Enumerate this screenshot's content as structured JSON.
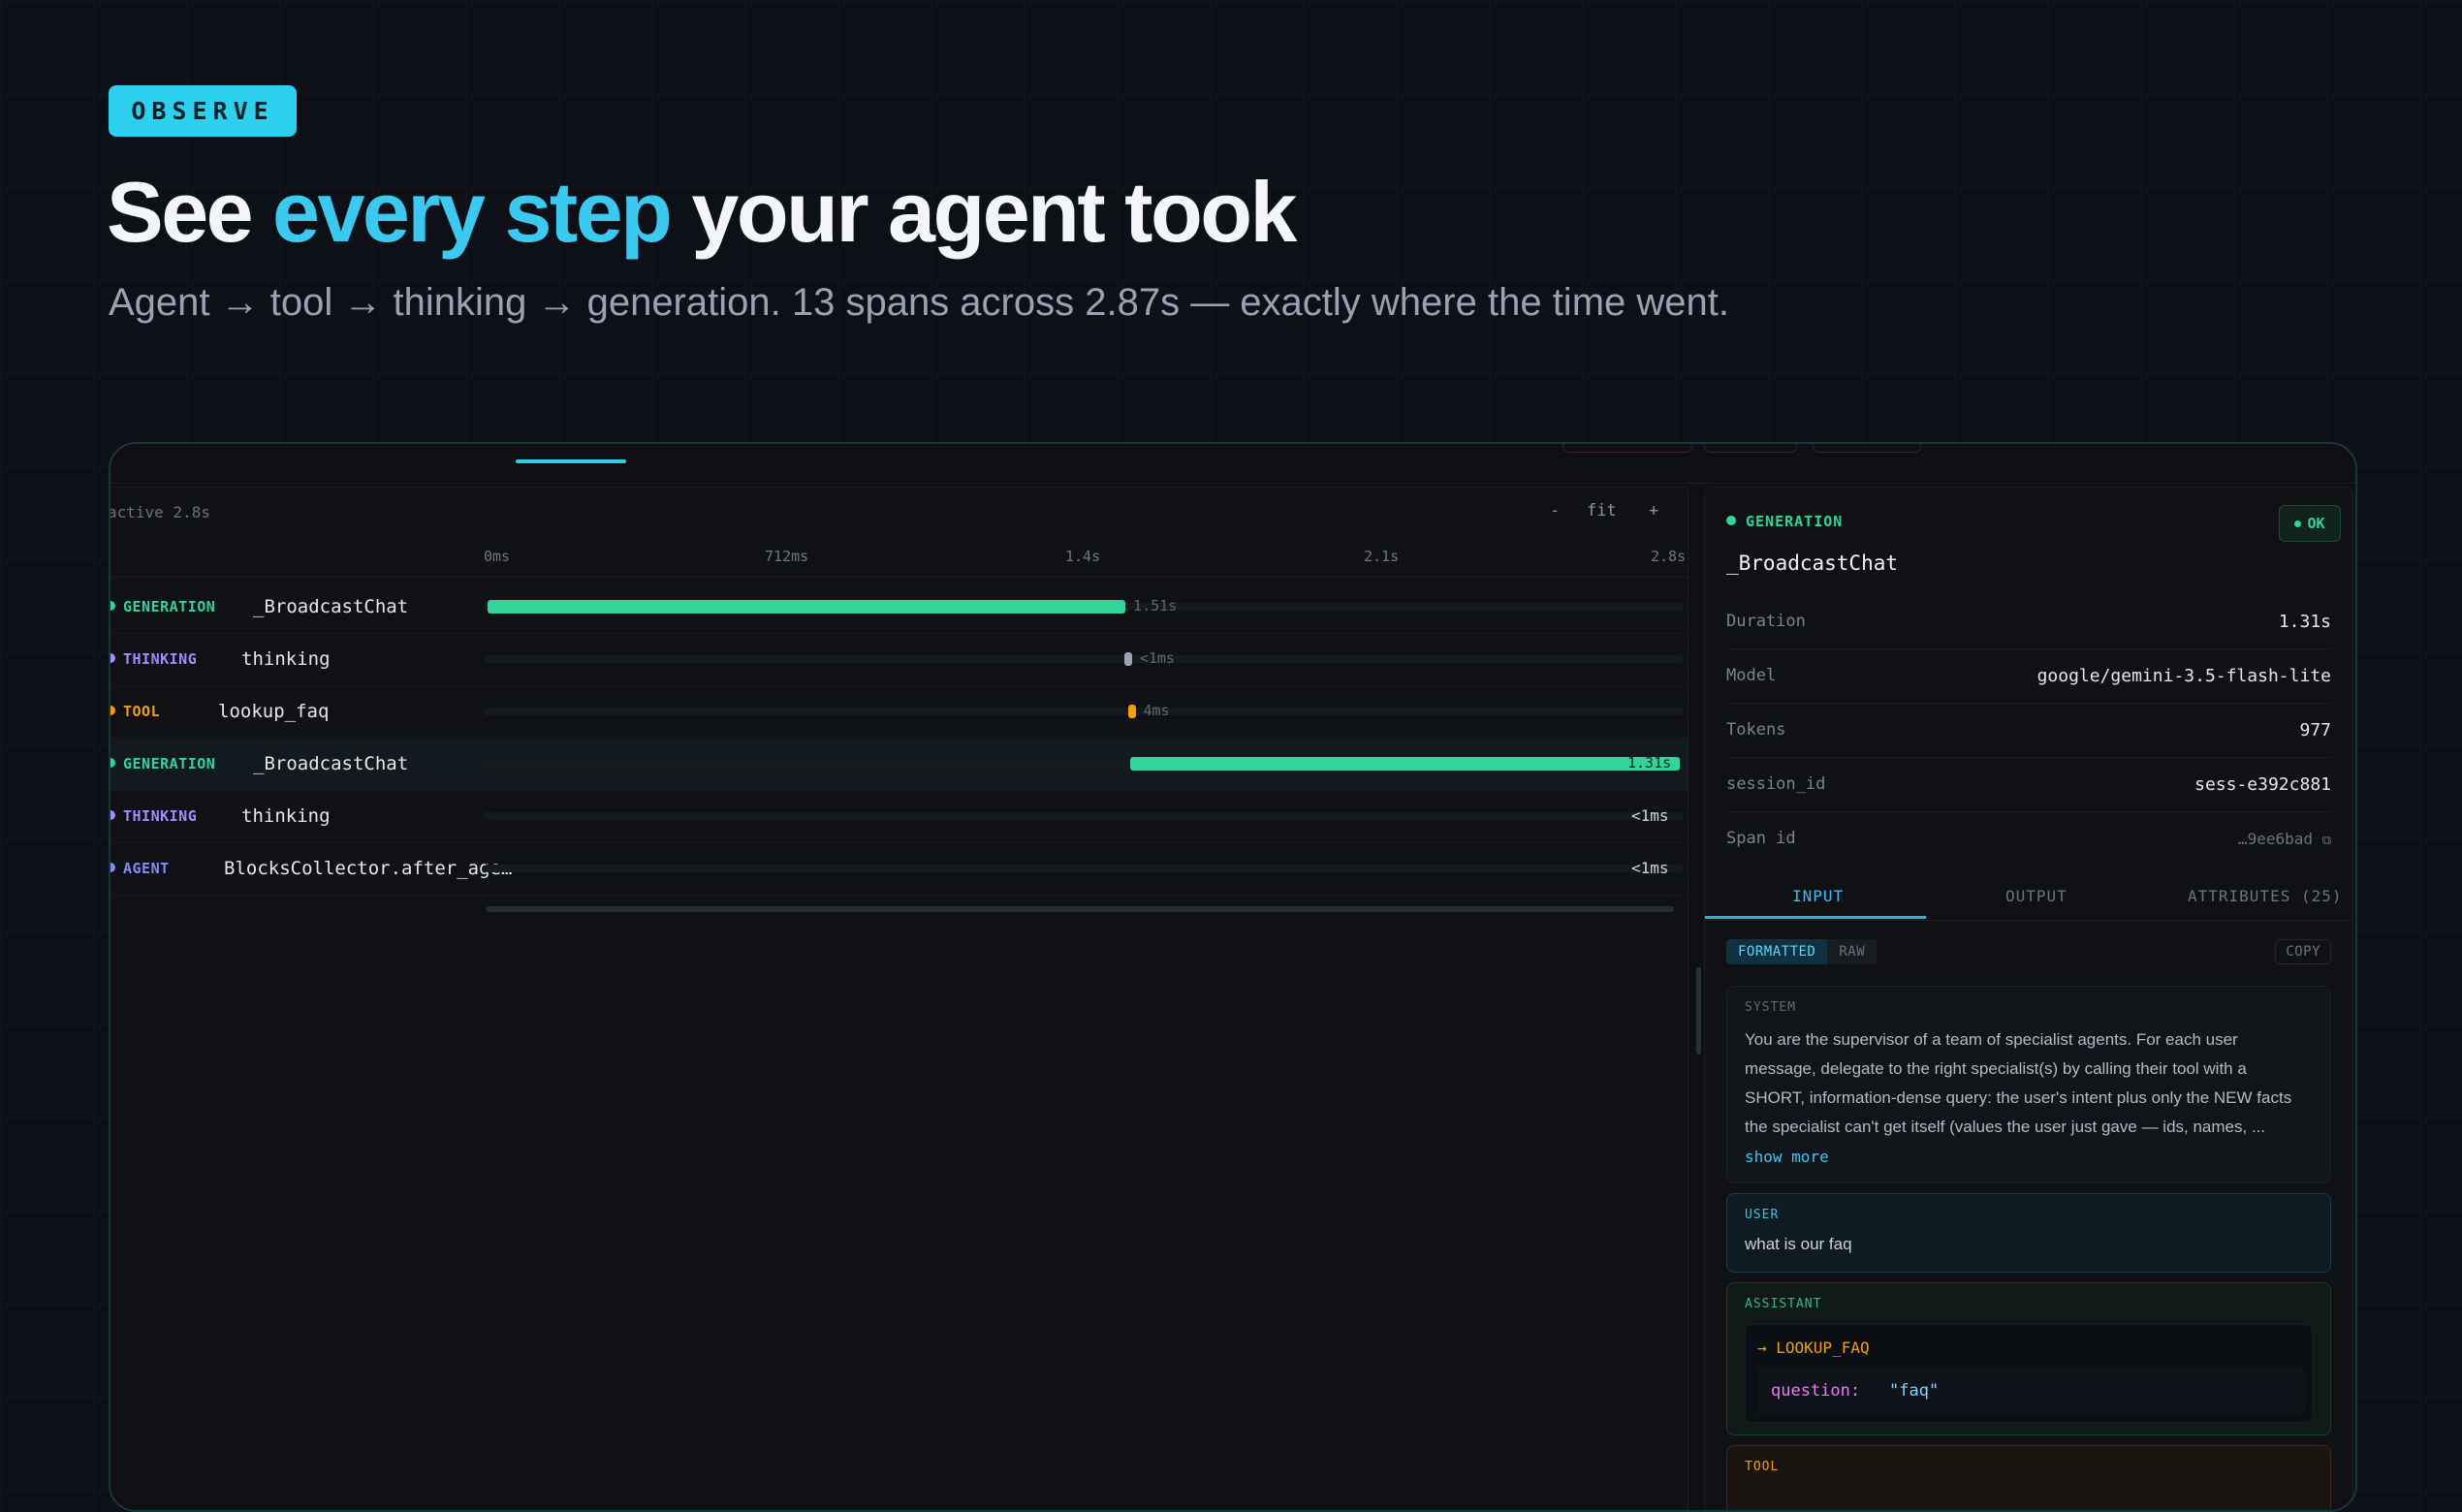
{
  "hero": {
    "badge": "OBSERVE",
    "title_pre": "See ",
    "title_accent": "every step",
    "title_post": " your agent took",
    "subtitle": "Agent → tool → thinking → generation. 13 spans across 2.87s — exactly where the time went."
  },
  "timeline": {
    "active_label": "active 2.8s",
    "zoom_out": "-",
    "zoom_fit": "fit",
    "zoom_in": "+",
    "ticks": [
      "0ms",
      "712ms",
      "1.4s",
      "2.1s",
      "2.8s"
    ],
    "rows": [
      {
        "type": "GENERATION",
        "name": "_BroadcastChat",
        "duration": "1.51s",
        "color": "#34d399",
        "start": 0.0,
        "end": 0.535
      },
      {
        "type": "THINKING",
        "name": "thinking",
        "duration": "<1ms",
        "color": "#a78bfa",
        "start": 0.534,
        "end": 0.54
      },
      {
        "type": "TOOL",
        "name": "lookup_faq",
        "duration": "4ms",
        "color": "#f59e0b",
        "start": 0.537,
        "end": 0.543
      },
      {
        "type": "GENERATION",
        "name": "_BroadcastChat",
        "duration": "1.31s",
        "color": "#34d399",
        "start": 0.539,
        "end": 1.0,
        "selected": true
      },
      {
        "type": "THINKING",
        "name": "thinking",
        "duration": "<1ms",
        "color": "#a78bfa",
        "start": 1.0,
        "end": 1.0
      },
      {
        "type": "AGENT",
        "name": "BlocksCollector.after_age…",
        "duration": "<1ms",
        "color": "#818cf8",
        "start": 1.0,
        "end": 1.0
      }
    ]
  },
  "detail": {
    "kind": "GENERATION",
    "status": "OK",
    "title": "_BroadcastChat",
    "meta": [
      {
        "key": "Duration",
        "value": "1.31s"
      },
      {
        "key": "Model",
        "value": "google/gemini-3.5-flash-lite"
      },
      {
        "key": "Tokens",
        "value": "977"
      },
      {
        "key": "session_id",
        "value": "sess-e392c881"
      },
      {
        "key": "Span id",
        "value": "…9ee6bad"
      }
    ],
    "tabs": [
      "INPUT",
      "OUTPUT",
      "ATTRIBUTES (25)"
    ],
    "format_on": "FORMATTED",
    "format_off": "RAW",
    "copy": "COPY",
    "system_role": "SYSTEM",
    "system_text": "You are the supervisor of a team of specialist agents. For each user message, delegate to the right specialist(s) by calling their tool with a SHORT, information-dense query: the user's intent plus only the NEW facts the specialist can't get itself (values the user just gave — ids, names, ...",
    "show_more": "show more",
    "user_role": "USER",
    "user_text": "what is our faq",
    "assistant_role": "ASSISTANT",
    "tool_call": "→ LOOKUP_FAQ",
    "arg_key": "question:",
    "arg_value": "\"faq\"",
    "tool_role": "TOOL"
  }
}
